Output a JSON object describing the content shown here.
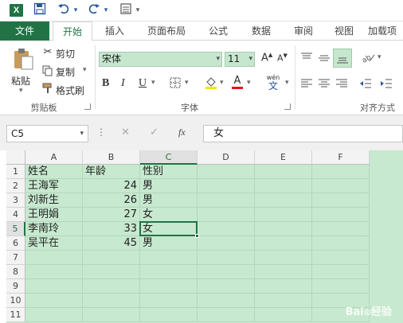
{
  "qat": {
    "excel_icon": "X",
    "save_icon": "save-icon",
    "undo_icon": "undo-icon",
    "redo_icon": "redo-icon",
    "form_icon": "form-icon"
  },
  "tabs": [
    "文件",
    "开始",
    "插入",
    "页面布局",
    "公式",
    "数据",
    "审阅",
    "视图",
    "加载项"
  ],
  "ribbon": {
    "clipboard": {
      "paste": "粘贴",
      "cut": "剪切",
      "copy": "复制",
      "format_painter": "格式刷",
      "label": "剪贴板"
    },
    "font": {
      "name": "宋体",
      "size": "11",
      "grow": "A",
      "shrink": "A",
      "bold": "B",
      "italic": "I",
      "underline": "U",
      "fill_letter": "A",
      "wen": "wén",
      "wen_char": "文",
      "label": "字体"
    },
    "alignment": {
      "label": "对齐方式"
    }
  },
  "formula_bar": {
    "name_box": "C5",
    "cancel": "✕",
    "enter": "✓",
    "fx": "fx",
    "value": "女"
  },
  "sheet": {
    "columns": [
      "A",
      "B",
      "C",
      "D",
      "E",
      "F"
    ],
    "rows": [
      "1",
      "2",
      "3",
      "4",
      "5",
      "6",
      "7",
      "8",
      "9",
      "10",
      "11"
    ],
    "selected_cell": "C5",
    "data": [
      [
        "姓名",
        "年龄",
        "性别"
      ],
      [
        "王海军",
        "24",
        "男"
      ],
      [
        "刘新生",
        "26",
        "男"
      ],
      [
        "王明娟",
        "27",
        "女"
      ],
      [
        "李南玲",
        "33",
        "女"
      ],
      [
        "吴平在",
        "45",
        "男"
      ]
    ]
  },
  "colors": {
    "accent": "#217346",
    "cell_fill": "#c7e9cf"
  }
}
